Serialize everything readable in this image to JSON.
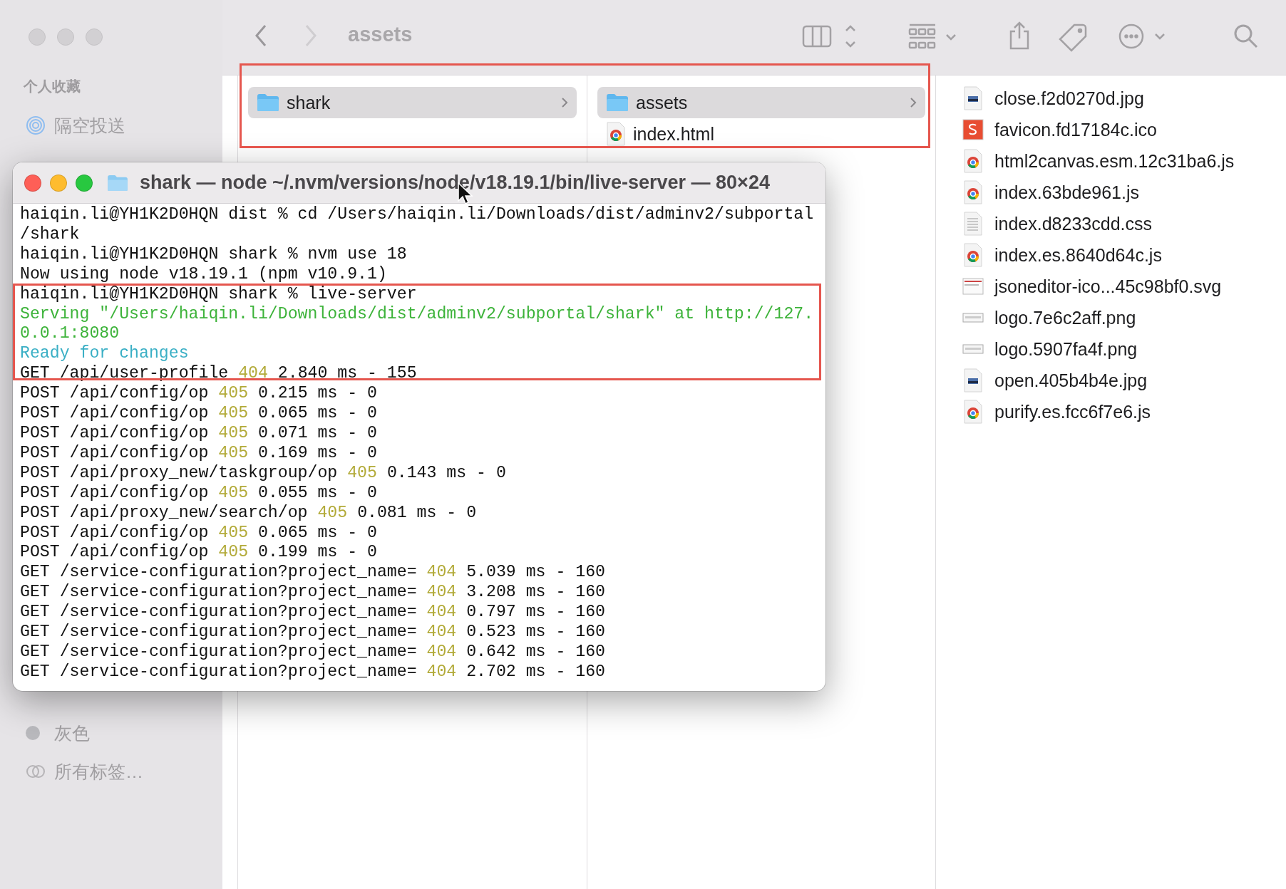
{
  "finder": {
    "title": "assets",
    "sidebar": {
      "section": "个人收藏",
      "items": [
        {
          "label": "隔空投送",
          "kind": "airdrop"
        }
      ],
      "tags": [
        {
          "label": "灰色",
          "color": "#b9b9bd"
        }
      ],
      "all_tags": "所有标签…"
    },
    "columns": [
      [
        {
          "name": "shark",
          "kind": "folder",
          "selected": true
        }
      ],
      [
        {
          "name": "assets",
          "kind": "folder",
          "selected": true
        },
        {
          "name": "index.html",
          "kind": "html",
          "selected": false
        }
      ]
    ],
    "files": [
      {
        "name": "close.f2d0270d.jpg",
        "kind": "image"
      },
      {
        "name": "favicon.fd17184c.ico",
        "kind": "ico"
      },
      {
        "name": "html2canvas.esm.12c31ba6.js",
        "kind": "js"
      },
      {
        "name": "index.63bde961.js",
        "kind": "js"
      },
      {
        "name": "index.d8233cdd.css",
        "kind": "css"
      },
      {
        "name": "index.es.8640d64c.js",
        "kind": "js"
      },
      {
        "name": "jsoneditor-ico...45c98bf0.svg",
        "kind": "svg"
      },
      {
        "name": "logo.7e6c2aff.png",
        "kind": "png"
      },
      {
        "name": "logo.5907fa4f.png",
        "kind": "png"
      },
      {
        "name": "open.405b4b4e.jpg",
        "kind": "image"
      },
      {
        "name": "purify.es.fcc6f7e6.js",
        "kind": "js"
      }
    ]
  },
  "terminal": {
    "title": "shark — node ~/.nvm/versions/node/v18.19.1/bin/live-server — 80×24",
    "lines": [
      {
        "kind": "prompt",
        "text": "haiqin.li@YH1K2D0HQN dist % cd /Users/haiqin.li/Downloads/dist/adminv2/subportal"
      },
      {
        "kind": "output",
        "text": "/shark"
      },
      {
        "kind": "prompt",
        "text": "haiqin.li@YH1K2D0HQN shark % nvm use 18"
      },
      {
        "kind": "output",
        "text": "Now using node v18.19.1 (npm v10.9.1)"
      },
      {
        "kind": "prompt",
        "text": "haiqin.li@YH1K2D0HQN shark % live-server"
      },
      {
        "kind": "serving",
        "text": "Serving \"/Users/haiqin.li/Downloads/dist/adminv2/subportal/shark\" at http://127."
      },
      {
        "kind": "serving",
        "text": "0.0.1:8080"
      },
      {
        "kind": "ready",
        "text": "Ready for changes"
      },
      {
        "kind": "log",
        "text": "GET /api/user-profile",
        "status": "404",
        "rest": "2.840 ms - 155"
      },
      {
        "kind": "log",
        "text": "POST /api/config/op",
        "status": "405",
        "rest": "0.215 ms - 0"
      },
      {
        "kind": "log",
        "text": "POST /api/config/op",
        "status": "405",
        "rest": "0.065 ms - 0"
      },
      {
        "kind": "log",
        "text": "POST /api/config/op",
        "status": "405",
        "rest": "0.071 ms - 0"
      },
      {
        "kind": "log",
        "text": "POST /api/config/op",
        "status": "405",
        "rest": "0.169 ms - 0"
      },
      {
        "kind": "log",
        "text": "POST /api/proxy_new/taskgroup/op",
        "status": "405",
        "rest": "0.143 ms - 0"
      },
      {
        "kind": "log",
        "text": "POST /api/config/op",
        "status": "405",
        "rest": "0.055 ms - 0"
      },
      {
        "kind": "log",
        "text": "POST /api/proxy_new/search/op",
        "status": "405",
        "rest": "0.081 ms - 0"
      },
      {
        "kind": "log",
        "text": "POST /api/config/op",
        "status": "405",
        "rest": "0.065 ms - 0"
      },
      {
        "kind": "log",
        "text": "POST /api/config/op",
        "status": "405",
        "rest": "0.199 ms - 0"
      },
      {
        "kind": "log",
        "text": "GET /service-configuration?project_name=",
        "status": "404",
        "rest": "5.039 ms - 160"
      },
      {
        "kind": "log",
        "text": "GET /service-configuration?project_name=",
        "status": "404",
        "rest": "3.208 ms - 160"
      },
      {
        "kind": "log",
        "text": "GET /service-configuration?project_name=",
        "status": "404",
        "rest": "0.797 ms - 160"
      },
      {
        "kind": "log",
        "text": "GET /service-configuration?project_name=",
        "status": "404",
        "rest": "0.523 ms - 160"
      },
      {
        "kind": "log",
        "text": "GET /service-configuration?project_name=",
        "status": "404",
        "rest": "0.642 ms - 160"
      },
      {
        "kind": "log",
        "text": "GET /service-configuration?project_name=",
        "status": "404",
        "rest": "2.702 ms - 160"
      }
    ]
  }
}
